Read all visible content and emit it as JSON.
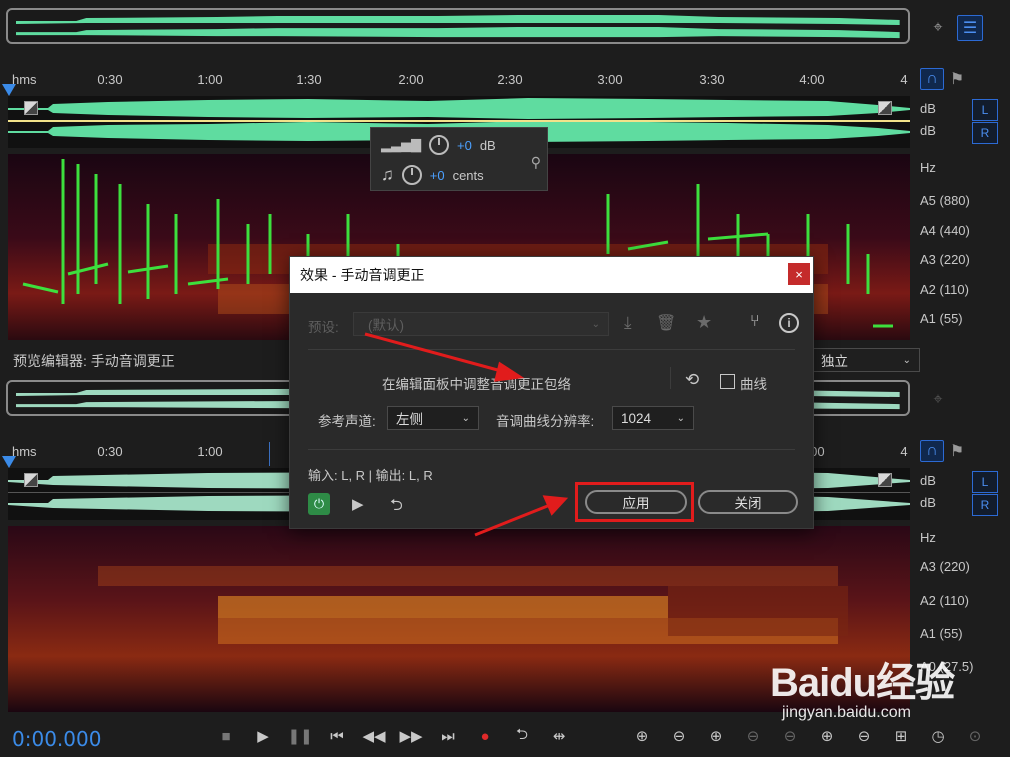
{
  "ruler_top": {
    "ticks": [
      "hms",
      "0:30",
      "1:00",
      "1:30",
      "2:00",
      "2:30",
      "3:00",
      "3:30",
      "4:00",
      "4"
    ]
  },
  "ruler_bottom": {
    "ticks": [
      "hms",
      "0:30",
      "1:00",
      "4:00",
      "4"
    ]
  },
  "track_labels": {
    "db1": "dB",
    "db2": "dB",
    "left": "L",
    "right": "R"
  },
  "hz_top": [
    "Hz",
    "A5 (880)",
    "A4 (440)",
    "A3 (220)",
    "A2 (110)",
    "A1 (55)"
  ],
  "hz_bottom": [
    "Hz",
    "A3 (220)",
    "A2 (110)",
    "A1 (55)",
    "A0 (27.5)"
  ],
  "hud": {
    "gain": "+0",
    "gain_unit": "dB",
    "cents": "+0",
    "cents_unit": "cents"
  },
  "preview_label": "预览编辑器: 手动音调更正",
  "preview_dropdown": "独立",
  "dialog": {
    "title": "效果 - 手动音调更正",
    "close": "×",
    "preset_label": "预设:",
    "preset_value": "(默认)",
    "description": "在编辑面板中调整音调更正包络",
    "curve_label": "曲线",
    "ref_channel_label": "参考声道:",
    "ref_channel_value": "左侧",
    "resolution_label": "音调曲线分辨率:",
    "resolution_value": "1024",
    "io": "输入: L, R | 输出: L, R",
    "apply": "应用",
    "close_btn": "关闭"
  },
  "transport": {
    "time": "0:00.000"
  },
  "watermark": {
    "brand": "Baidu经验",
    "url": "jingyan.baidu.com"
  },
  "colors": {
    "accent": "#3b8be8",
    "wave": "#5fdca0",
    "pitch": "#3de03d",
    "highlight": "#e11c1c"
  }
}
